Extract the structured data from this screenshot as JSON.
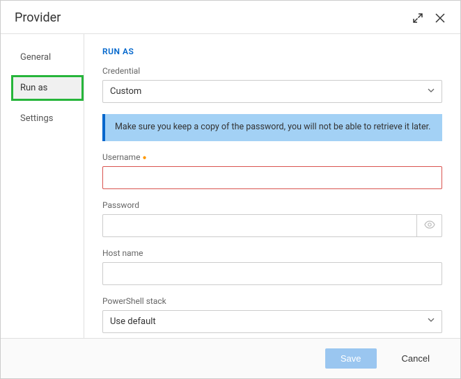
{
  "header": {
    "title": "Provider"
  },
  "sidebar": {
    "items": [
      {
        "label": "General"
      },
      {
        "label": "Run as"
      },
      {
        "label": "Settings"
      }
    ]
  },
  "section": {
    "title": "RUN AS"
  },
  "fields": {
    "credential": {
      "label": "Credential",
      "value": "Custom"
    },
    "info_banner": "Make sure you keep a copy of the password, you will not be able to retrieve it later.",
    "username": {
      "label": "Username",
      "value": ""
    },
    "password": {
      "label": "Password",
      "value": ""
    },
    "hostname": {
      "label": "Host name",
      "value": ""
    },
    "powershell": {
      "label": "PowerShell stack",
      "value": "Use default"
    }
  },
  "footer": {
    "save": "Save",
    "cancel": "Cancel"
  }
}
